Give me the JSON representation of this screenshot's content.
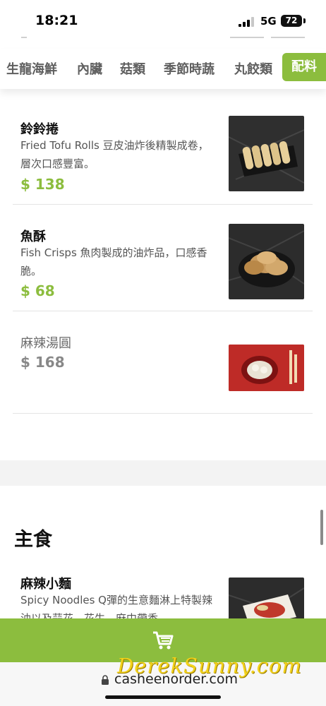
{
  "status_bar": {
    "time": "18:21",
    "network": "5G",
    "battery": "72"
  },
  "category_tabs": {
    "items": [
      "生龍海鮮",
      "內臟",
      "菇類",
      "季節時蔬",
      "丸餃類"
    ],
    "active": "配料"
  },
  "menu_items": [
    {
      "name": "鈴鈴捲",
      "description": "Fried Tofu Rolls 豆皮油炸後精製成卷，層次口感豐富。",
      "price": "$ 138"
    },
    {
      "name": "魚酥",
      "description": "Fish Crisps 魚肉製成的油炸品，口感香脆。",
      "price": "$ 68"
    },
    {
      "name": "麻辣湯圓",
      "price": "$ 168"
    }
  ],
  "next_section": {
    "title": "主食",
    "items": [
      {
        "name": "麻辣小麵",
        "description": "Spicy Noodles Q彈的生意麵淋上特製辣油以及蒜花、花生，麻中帶香"
      }
    ]
  },
  "cart": {
    "icon": "shopping-cart-icon"
  },
  "browser": {
    "url": "casheenorder.com"
  },
  "watermark": "DerekSunny.com",
  "colors": {
    "accent": "#8cbd3e",
    "watermark": "#f3d21a"
  }
}
